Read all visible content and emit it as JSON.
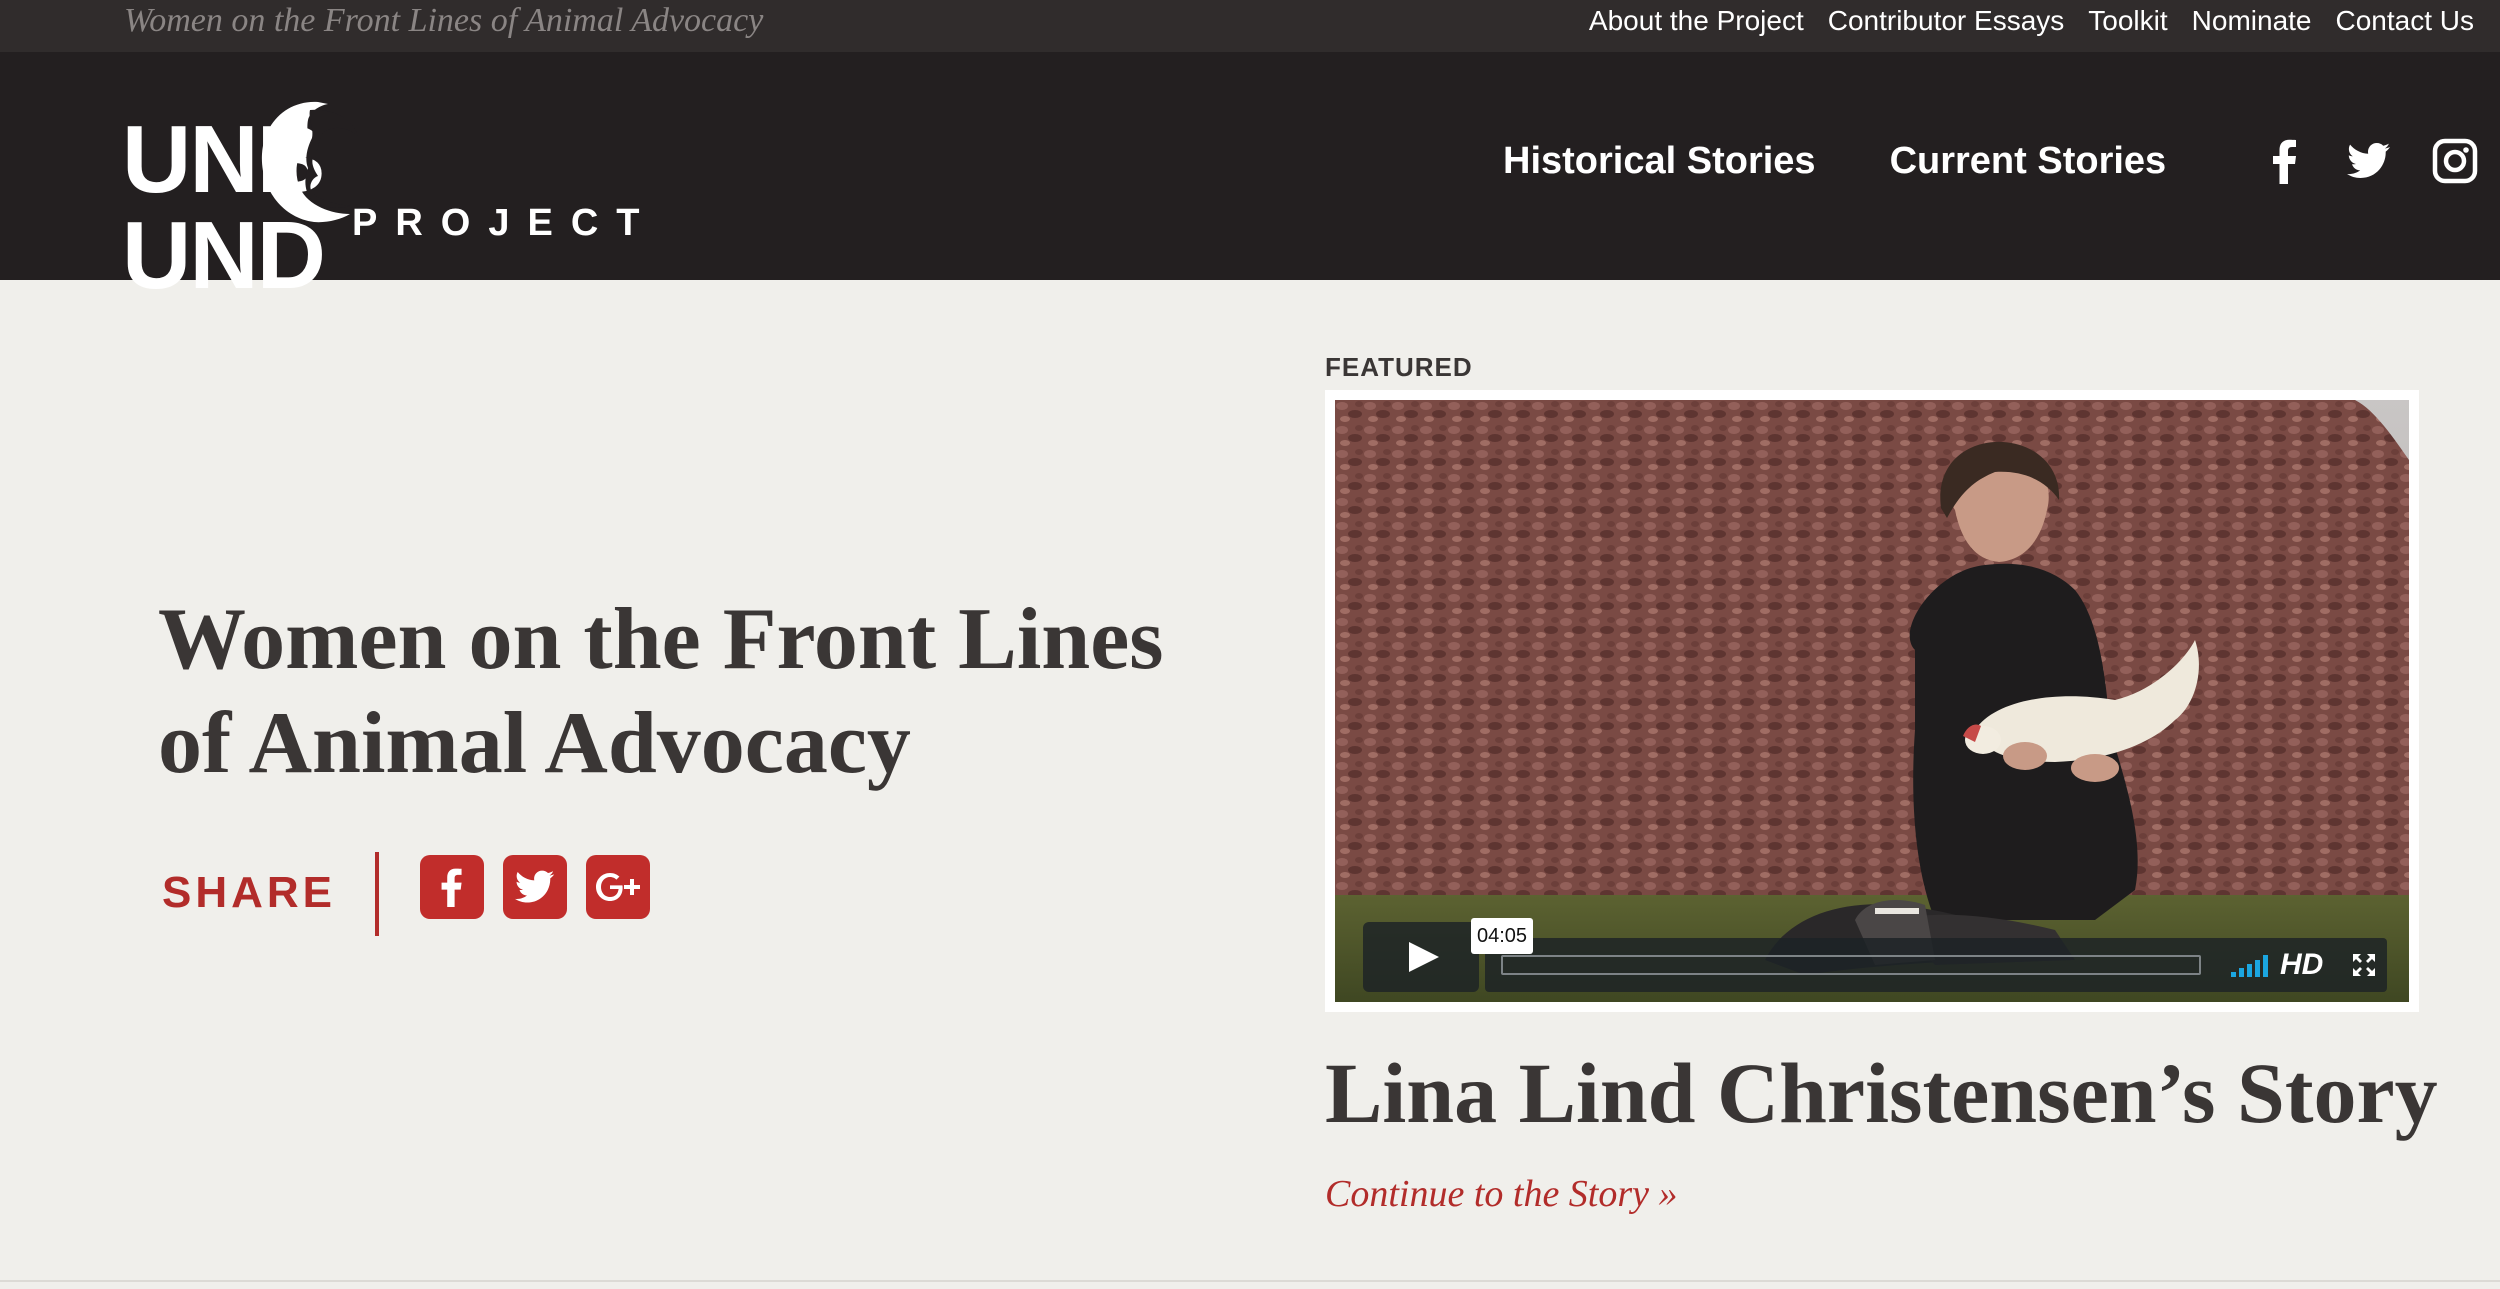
{
  "topbar": {
    "tagline": "Women on the Front Lines of Animal Advocacy",
    "nav": [
      "About the Project",
      "Contributor Essays",
      "Toolkit",
      "Nominate",
      "Contact Us"
    ]
  },
  "header": {
    "logo_word_left": "UNB",
    "logo_word_right": "UND",
    "logo_sub": "PROJECT",
    "nav": [
      "Historical Stories",
      "Current Stories"
    ],
    "social_icons": [
      "facebook-icon",
      "twitter-icon",
      "instagram-icon"
    ]
  },
  "hero": {
    "title_line1": "Women on the Front Lines",
    "title_line2": "of Animal Advocacy",
    "share_label": "SHARE",
    "share_icons": [
      "facebook-icon",
      "twitter-icon",
      "google-plus-icon"
    ]
  },
  "featured": {
    "label": "FEATURED",
    "video": {
      "duration": "04:05",
      "quality": "HD",
      "progress": 0
    },
    "story_title": "Lina Lind Christensen’s Story",
    "link_text": "Continue to the Story »"
  },
  "colors": {
    "accent": "#b22c2a",
    "header_bg": "#231f20",
    "topbar_bg": "#302c2c",
    "page_bg": "#f0efeb"
  }
}
